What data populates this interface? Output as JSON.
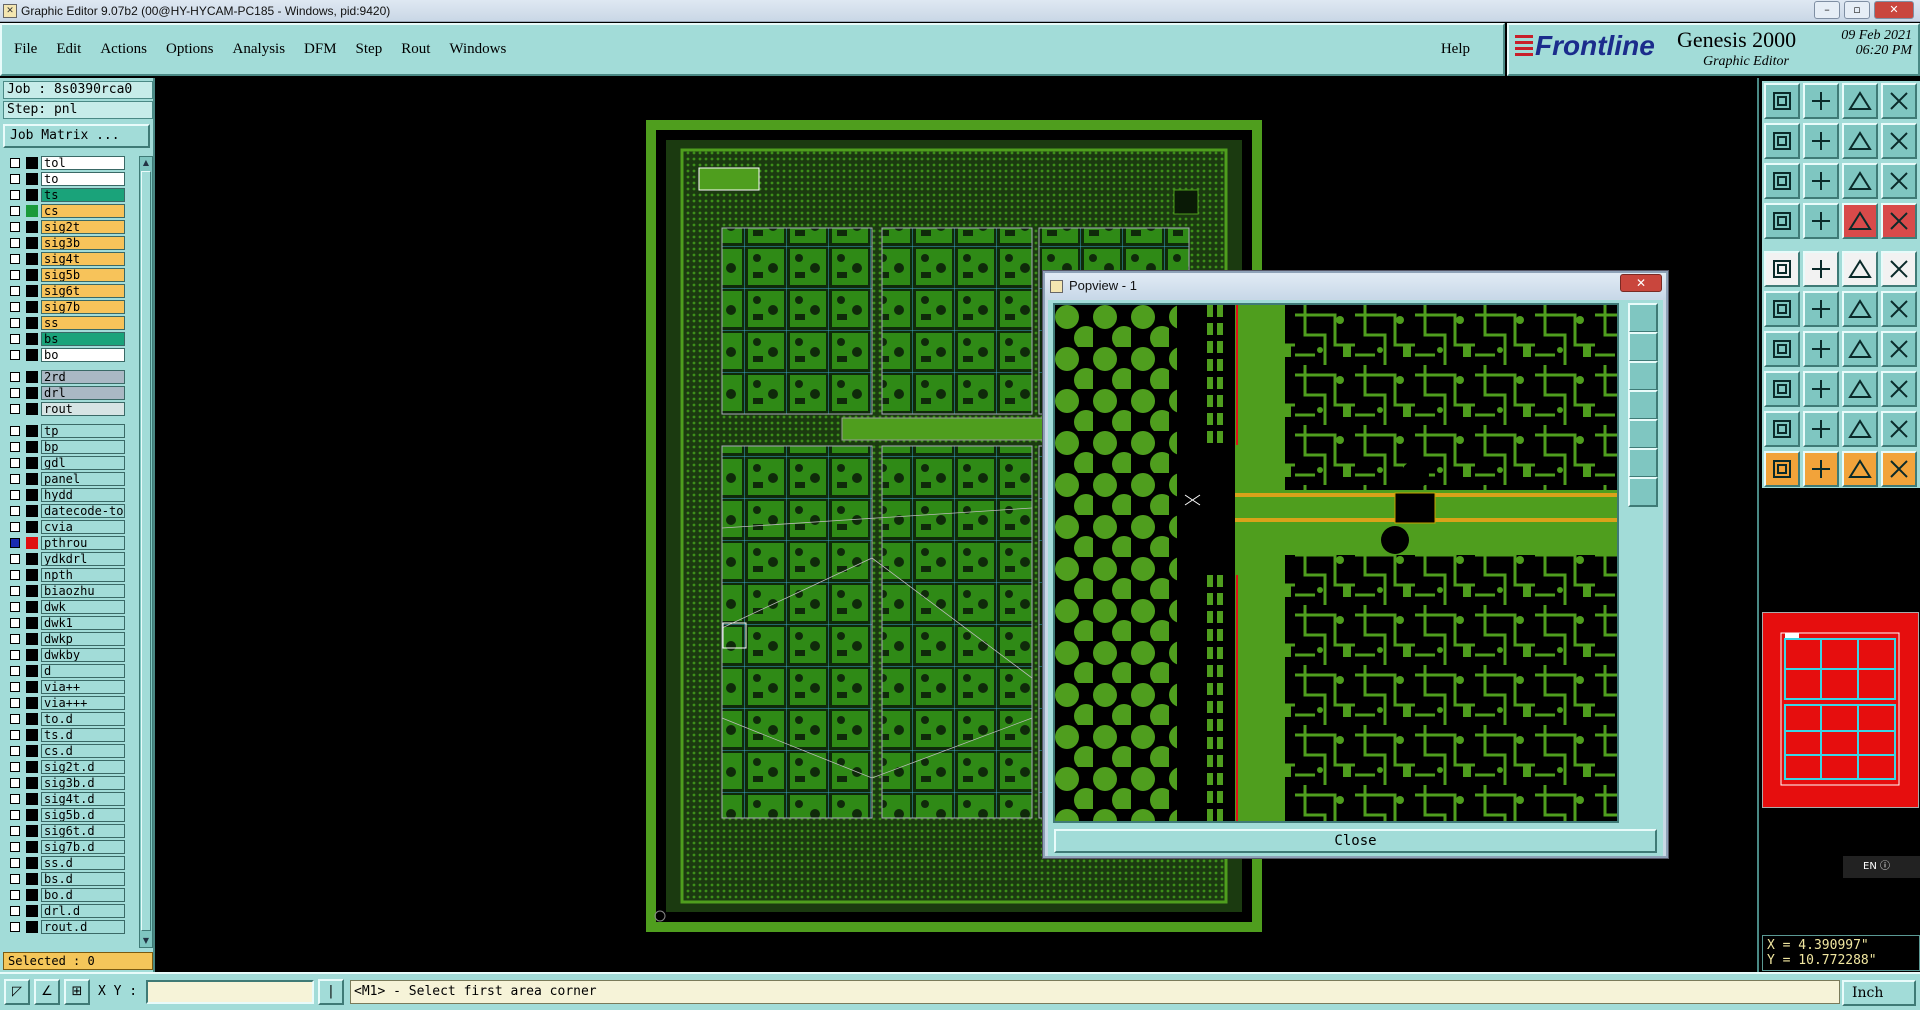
{
  "window": {
    "title": "Graphic Editor 9.07b2 (00@HY-HYCAM-PC185 - Windows, pid:9420)",
    "controls": [
      "–",
      "▫",
      "✕"
    ]
  },
  "menu": {
    "items": [
      "File",
      "Edit",
      "Actions",
      "Options",
      "Analysis",
      "DFM",
      "Step",
      "Rout",
      "Windows"
    ],
    "help": "Help"
  },
  "brand": {
    "logo": "Frontline",
    "product": "Genesis 2000",
    "subtitle": "Graphic Editor",
    "date": "09 Feb 2021",
    "time": "06:20 PM"
  },
  "job": {
    "job_line": "Job : 8s0390rca0",
    "step_line": "Step: pnl",
    "job_matrix_button": "Job Matrix ..."
  },
  "layers": [
    {
      "name": "tol",
      "color": "#ffffff",
      "lamp": "black",
      "checked": false
    },
    {
      "name": "to",
      "color": "#ffffff",
      "lamp": "black",
      "checked": false
    },
    {
      "name": "ts",
      "color": "#1aa37a",
      "lamp": "black",
      "checked": false
    },
    {
      "name": "cs",
      "color": "#f7c35a",
      "lamp": "green",
      "checked": false
    },
    {
      "name": "sig2t",
      "color": "#f7c35a",
      "lamp": "black",
      "checked": false
    },
    {
      "name": "sig3b",
      "color": "#f7c35a",
      "lamp": "black",
      "checked": false
    },
    {
      "name": "sig4t",
      "color": "#f7c35a",
      "lamp": "black",
      "checked": false
    },
    {
      "name": "sig5b",
      "color": "#f7c35a",
      "lamp": "black",
      "checked": false
    },
    {
      "name": "sig6t",
      "color": "#f7c35a",
      "lamp": "black",
      "checked": false
    },
    {
      "name": "sig7b",
      "color": "#f7c35a",
      "lamp": "black",
      "checked": false
    },
    {
      "name": "ss",
      "color": "#f7c35a",
      "lamp": "black",
      "checked": false
    },
    {
      "name": "bs",
      "color": "#1aa37a",
      "lamp": "black",
      "checked": false
    },
    {
      "name": "bo",
      "color": "#ffffff",
      "lamp": "black",
      "checked": false
    },
    {
      "name": "2rd",
      "color": "#aab8c4",
      "lamp": "black",
      "checked": false
    },
    {
      "name": "drl",
      "color": "#aab8c4",
      "lamp": "black",
      "checked": false
    },
    {
      "name": "rout",
      "color": "#d6e4e4",
      "lamp": "black",
      "checked": false
    },
    {
      "name": "tp",
      "color": "#a2dcd8",
      "lamp": "black",
      "checked": false
    },
    {
      "name": "bp",
      "color": "#a2dcd8",
      "lamp": "black",
      "checked": false
    },
    {
      "name": "gdl",
      "color": "#a2dcd8",
      "lamp": "black",
      "checked": false
    },
    {
      "name": "panel",
      "color": "#a2dcd8",
      "lamp": "black",
      "checked": false
    },
    {
      "name": "hydd",
      "color": "#a2dcd8",
      "lamp": "black",
      "checked": false
    },
    {
      "name": "datecode-to",
      "color": "#a2dcd8",
      "lamp": "black",
      "checked": false
    },
    {
      "name": "cvia",
      "color": "#a2dcd8",
      "lamp": "black",
      "checked": false
    },
    {
      "name": "pthrou",
      "color": "#a2dcd8",
      "lamp": "red",
      "checked": true
    },
    {
      "name": "ydkdrl",
      "color": "#a2dcd8",
      "lamp": "black",
      "checked": false
    },
    {
      "name": "npth",
      "color": "#a2dcd8",
      "lamp": "black",
      "checked": false
    },
    {
      "name": "biaozhu",
      "color": "#a2dcd8",
      "lamp": "black",
      "checked": false
    },
    {
      "name": "dwk",
      "color": "#a2dcd8",
      "lamp": "black",
      "checked": false
    },
    {
      "name": "dwk1",
      "color": "#a2dcd8",
      "lamp": "black",
      "checked": false
    },
    {
      "name": "dwkp",
      "color": "#a2dcd8",
      "lamp": "black",
      "checked": false
    },
    {
      "name": "dwkby",
      "color": "#a2dcd8",
      "lamp": "black",
      "checked": false
    },
    {
      "name": "d",
      "color": "#a2dcd8",
      "lamp": "black",
      "checked": false
    },
    {
      "name": "via++",
      "color": "#a2dcd8",
      "lamp": "black",
      "checked": false
    },
    {
      "name": "via+++",
      "color": "#a2dcd8",
      "lamp": "black",
      "checked": false
    },
    {
      "name": "to.d",
      "color": "#a2dcd8",
      "lamp": "black",
      "checked": false
    },
    {
      "name": "ts.d",
      "color": "#a2dcd8",
      "lamp": "black",
      "checked": false
    },
    {
      "name": "cs.d",
      "color": "#a2dcd8",
      "lamp": "black",
      "checked": false
    },
    {
      "name": "sig2t.d",
      "color": "#a2dcd8",
      "lamp": "black",
      "checked": false
    },
    {
      "name": "sig3b.d",
      "color": "#a2dcd8",
      "lamp": "black",
      "checked": false
    },
    {
      "name": "sig4t.d",
      "color": "#a2dcd8",
      "lamp": "black",
      "checked": false
    },
    {
      "name": "sig5b.d",
      "color": "#a2dcd8",
      "lamp": "black",
      "checked": false
    },
    {
      "name": "sig6t.d",
      "color": "#a2dcd8",
      "lamp": "black",
      "checked": false
    },
    {
      "name": "sig7b.d",
      "color": "#a2dcd8",
      "lamp": "black",
      "checked": false
    },
    {
      "name": "ss.d",
      "color": "#a2dcd8",
      "lamp": "black",
      "checked": false
    },
    {
      "name": "bs.d",
      "color": "#a2dcd8",
      "lamp": "black",
      "checked": false
    },
    {
      "name": "bo.d",
      "color": "#a2dcd8",
      "lamp": "black",
      "checked": false
    },
    {
      "name": "drl.d",
      "color": "#a2dcd8",
      "lamp": "black",
      "checked": false
    },
    {
      "name": "rout.d",
      "color": "#a2dcd8",
      "lamp": "black",
      "checked": false
    }
  ],
  "selected": "Selected : 0",
  "popview": {
    "title": "Popview - 1",
    "close_button": "Close"
  },
  "coords": {
    "x": "X = 4.390997\"",
    "y": "Y = 10.772288\""
  },
  "bottom": {
    "xy_label": "X Y :",
    "xy_value": "",
    "prompt": "<M1> - Select first area corner",
    "units": "Inch"
  },
  "language_indicator": "EN",
  "colors": {
    "panel": "#a2dcd8",
    "board_green": "#3d8f1a",
    "pcb_dark": "#0f2a0a"
  }
}
